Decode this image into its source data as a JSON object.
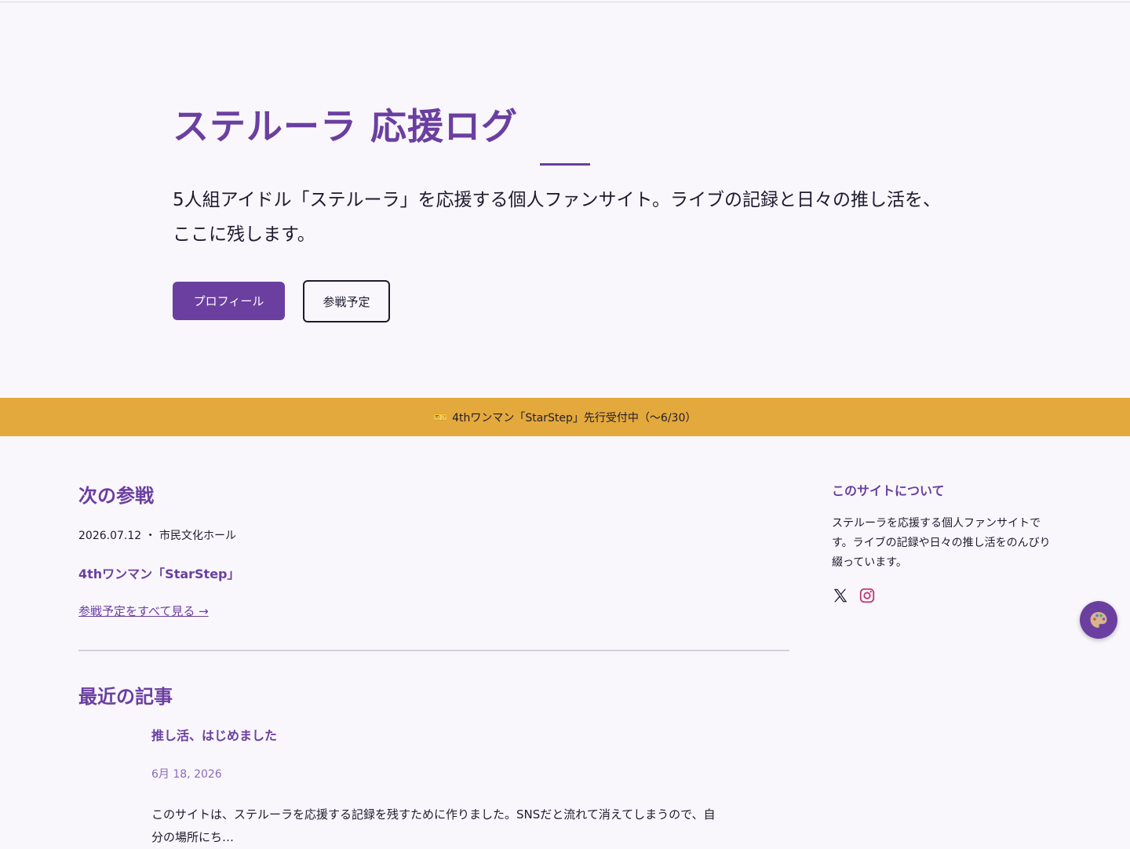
{
  "hero": {
    "title": "ステルーラ 応援ログ",
    "lead": "5人組アイドル「ステルーラ」を応援する個人ファンサイト。ライブの記録と日々の推し活を、ここに残します。",
    "primary_button": "プロフィール",
    "secondary_button": "参戦予定"
  },
  "banner": {
    "icon": "🎫",
    "text": "4thワンマン「StarStep」先行受付中（〜6/30）"
  },
  "next": {
    "heading": "次の参戦",
    "meta": "2026.07.12 ・ 市民文化ホール",
    "event": "4thワンマン「StarStep」",
    "link": "参戦予定をすべて見る →"
  },
  "recent": {
    "heading": "最近の記事",
    "posts": [
      {
        "title": "推し活、はじめました",
        "date": "6月 18, 2026",
        "excerpt": "このサイトは、ステルーラを応援する記録を残すために作りました。SNSだと流れて消えてしまうので、自分の場所にち…"
      }
    ]
  },
  "sidebar": {
    "heading": "このサイトについて",
    "text": "ステルーラを応援する個人ファンサイトです。ライブの記録や日々の推し活をのんびり綴っています。",
    "icons": [
      "x-icon",
      "instagram-icon"
    ]
  },
  "fab": {
    "icon": "palette-icon"
  },
  "colors": {
    "accent": "#6b3fa0",
    "banner": "#e4a93c",
    "background": "#f9f7fc"
  }
}
